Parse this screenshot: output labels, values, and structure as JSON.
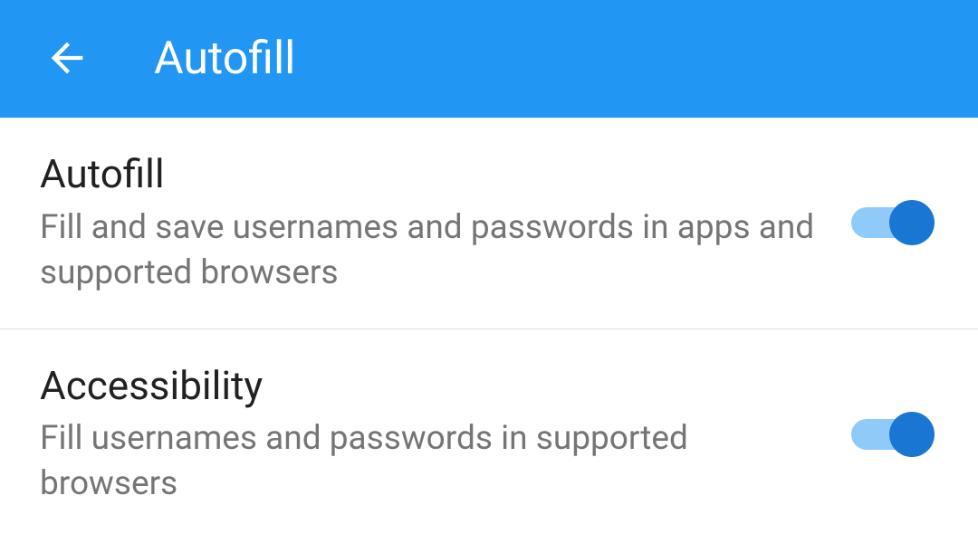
{
  "header": {
    "title": "Autofill"
  },
  "settings": [
    {
      "title": "Autofill",
      "description": "Fill and save usernames and passwords in apps and supported browsers",
      "enabled": true
    },
    {
      "title": "Accessibility",
      "description": "Fill usernames and passwords in supported browsers",
      "enabled": true
    }
  ]
}
